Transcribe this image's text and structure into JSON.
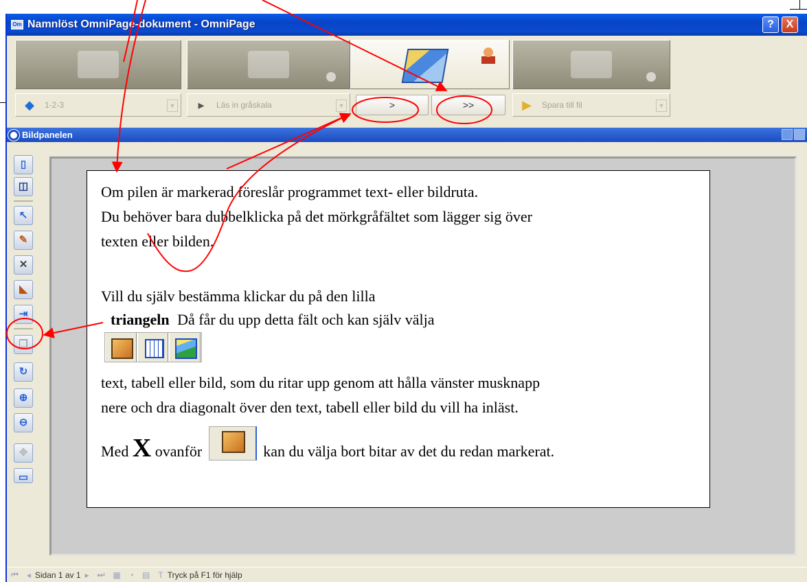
{
  "window": {
    "title": "Namnlöst OmniPage-dokument - OmniPage",
    "app_icon_text": "Om",
    "help_button": "?",
    "close_button": "X"
  },
  "toolbar": {
    "stage_1_combo": "1-2-3",
    "stage_2_combo": "Läs in gråskala",
    "stage_4_combo": "Spara till fil",
    "next_button": ">",
    "fast_forward_button": ">>"
  },
  "panel": {
    "title": "Bildpanelen"
  },
  "callout": {
    "line1": "Om pilen är markerad föreslår programmet text- eller bildruta.",
    "line2": "Du behöver bara dubbelklicka på det mörkgråfältet som lägger sig över",
    "line3": "texten eller bilden.",
    "line4": "Vill du själv bestämma klickar du på den lilla",
    "line5_bold": "triangeln",
    "line5_rest": "Då får du upp detta fält och kan själv välja",
    "line6": "text, tabell eller bild, som du ritar upp genom att hålla vänster musknapp",
    "line7": "nere och dra diagonalt över den text, tabell eller bild du vill ha inläst.",
    "line8_pre": "Med",
    "line8_x": "X",
    "line8_mid": "ovanför",
    "line8_post": "kan du välja bort bitar av det du redan markerat."
  },
  "statusbar": {
    "page_label": "Sidan 1 av 1",
    "help_text": "Tryck på F1 för hjälp"
  },
  "colors": {
    "titlebar": "#0a4bd0",
    "annotation": "#ff0000",
    "canvas": "#cccccc"
  }
}
